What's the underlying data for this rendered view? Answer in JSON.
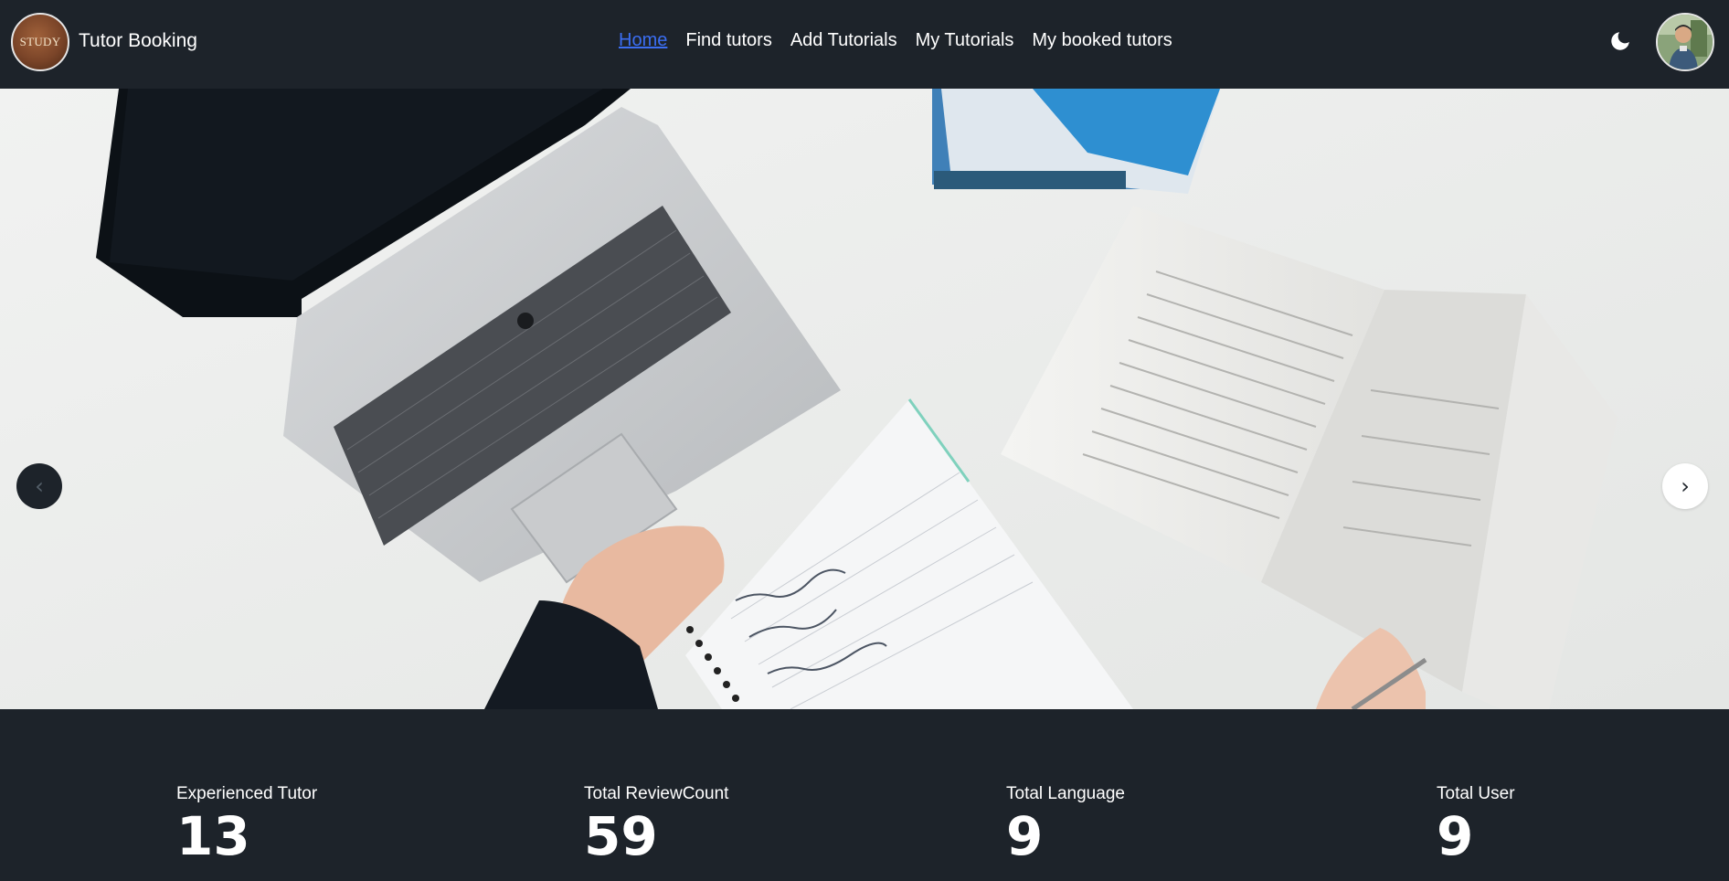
{
  "brand": {
    "logo_text": "STUDY",
    "title": "Tutor Booking"
  },
  "nav": {
    "items": [
      {
        "label": "Home",
        "active": true
      },
      {
        "label": "Find tutors",
        "active": false
      },
      {
        "label": "Add Tutorials",
        "active": false
      },
      {
        "label": "My Tutorials",
        "active": false
      },
      {
        "label": "My booked tutors",
        "active": false
      }
    ]
  },
  "header": {
    "theme_icon": "moon-icon",
    "avatar_icon": "user-avatar"
  },
  "carousel": {
    "prev_label": "‹",
    "next_label": "›",
    "slide_image": "laptop-notebook-book-desk-photo"
  },
  "stats": [
    {
      "label": "Experienced Tutor",
      "value": "13"
    },
    {
      "label": "Total ReviewCount",
      "value": "59"
    },
    {
      "label": "Total Language",
      "value": "9"
    },
    {
      "label": "Total User",
      "value": "9"
    }
  ],
  "colors": {
    "background": "#1d232a",
    "active_link": "#3b6ef2",
    "text": "#ffffff"
  }
}
